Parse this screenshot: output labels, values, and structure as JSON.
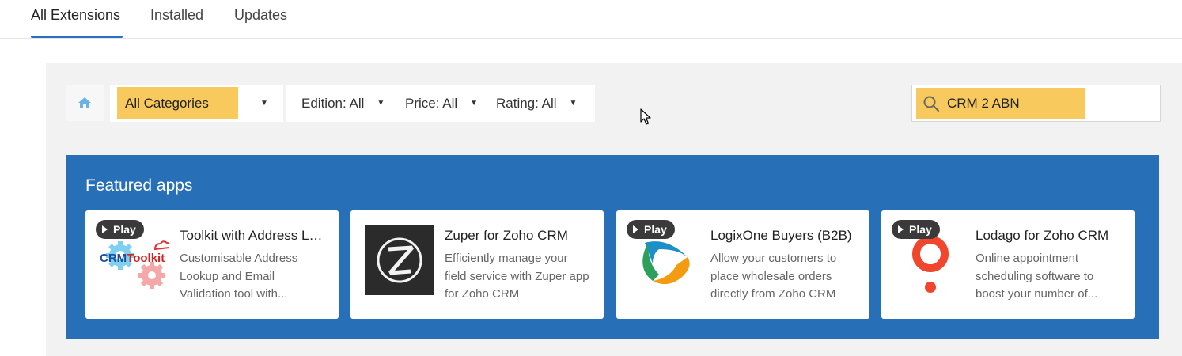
{
  "tabs": [
    {
      "label": "All Extensions",
      "active": true
    },
    {
      "label": "Installed",
      "active": false
    },
    {
      "label": "Updates",
      "active": false
    }
  ],
  "toolbar": {
    "home_icon": "home-icon",
    "category": "All Categories",
    "edition": "Edition: All",
    "price": "Price: All",
    "rating": "Rating: All",
    "search_value": "CRM 2 ABN",
    "highlight_color": "#f8c95c"
  },
  "featured": {
    "title": "Featured apps",
    "background": "#2770b8",
    "play_label": "Play",
    "apps": [
      {
        "title": "Toolkit with Address Lookup and Email Validation",
        "desc": "Customisable Address Lookup and Email Validation tool with...",
        "logo_text": "CRMToolkit",
        "has_play": true
      },
      {
        "title": "Zuper for Zoho CRM",
        "desc": "Efficiently manage your field service with Zuper app for Zoho CRM",
        "has_play": false
      },
      {
        "title": "LogixOne Buyers (B2B)",
        "desc": "Allow your customers to place wholesale orders directly from Zoho CRM",
        "has_play": true
      },
      {
        "title": "Lodago for Zoho CRM",
        "desc": "Online appointment scheduling software to boost your number of...",
        "has_play": true
      }
    ]
  }
}
